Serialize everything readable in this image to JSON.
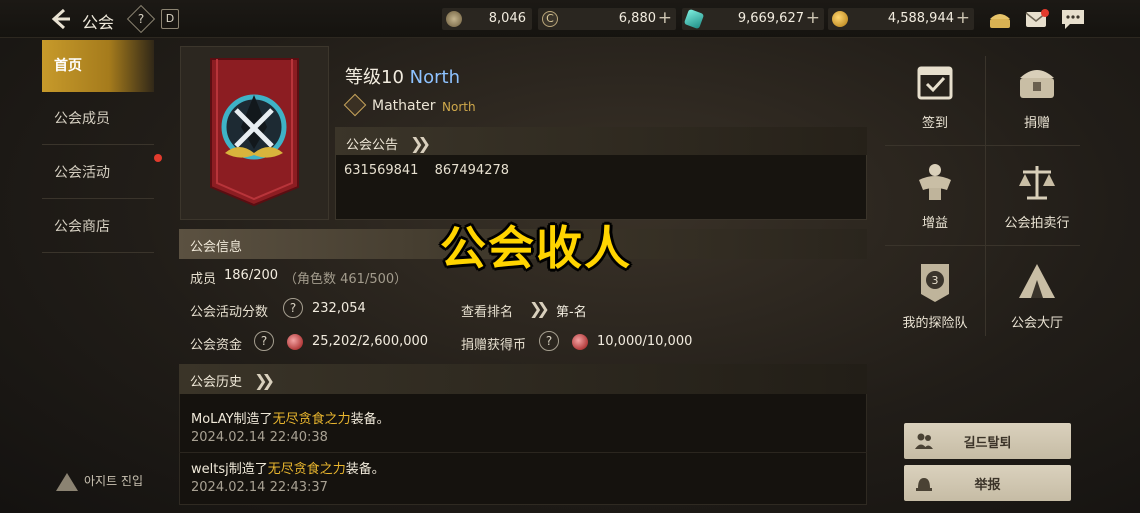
{
  "topbar": {
    "back_icon": "back-arrow-icon",
    "title": "公会",
    "help_label": "?",
    "d_label": "D",
    "resources": [
      {
        "icon": "shard-icon",
        "value": "8,046",
        "plus": false
      },
      {
        "icon": "c-coin-icon",
        "value": "6,880",
        "plus": true
      },
      {
        "icon": "crystal-icon",
        "value": "9,669,627",
        "plus": true
      },
      {
        "icon": "gold-coin-icon",
        "value": "4,588,944",
        "plus": true
      }
    ],
    "plus_label": "+",
    "right_icons": [
      "treasure-icon",
      "mail-icon",
      "chat-icon"
    ]
  },
  "menu": {
    "items": [
      "首页",
      "公会成员",
      "公会活动",
      "公会商店"
    ],
    "hideout_label": "아지트 진입"
  },
  "guild": {
    "level_text": "等级10",
    "server": "North",
    "leader": "Mathater",
    "leader_server": "North",
    "notice_title": "公会公告",
    "notice_text": "631569841 867494278"
  },
  "info": {
    "title": "公会信息",
    "members_label": "成员",
    "members_value": "186/200",
    "members_extra": "（角色数 461/500）",
    "activity_label": "公会活动分数",
    "activity_value": "232,054",
    "rank_label": "查看排名",
    "rank_value": "第-名",
    "funds_label": "公会资金",
    "funds_value": "25,202/2,600,000",
    "donate_label": "捐赠获得币",
    "donate_value": "10,000/10,000",
    "help_label": "?"
  },
  "history": {
    "title": "公会历史",
    "entries": [
      {
        "player": "MoLAY",
        "prefix": "制造了",
        "item": "无尽贪食之力",
        "suffix": "装备。",
        "date": "2024.02.14 22:40:38"
      },
      {
        "player": "weltsj",
        "prefix": "制造了",
        "item": "无尽贪食之力",
        "suffix": "装备。",
        "date": "2024.02.14 22:43:37"
      }
    ]
  },
  "overlay_text": "公会收人",
  "right": {
    "cells": [
      {
        "label": "签到",
        "icon": "checkin-icon"
      },
      {
        "label": "捐赠",
        "icon": "donate-chest-icon"
      },
      {
        "label": "增益",
        "icon": "buff-icon"
      },
      {
        "label": "公会拍卖行",
        "icon": "auction-scale-icon"
      },
      {
        "label": "我的探险队",
        "icon": "expedition-badge-icon"
      },
      {
        "label": "公会大厅",
        "icon": "guild-tent-icon"
      }
    ],
    "leave_label": "길드탈퇴",
    "report_label": "举报"
  },
  "colors": {
    "accent_gold": "#c79a2b",
    "highlight_yellow": "#e8b52e",
    "server_blue": "#8ec2ff",
    "overlay_yellow": "#ffd400",
    "notify_red": "#e23b2d"
  }
}
